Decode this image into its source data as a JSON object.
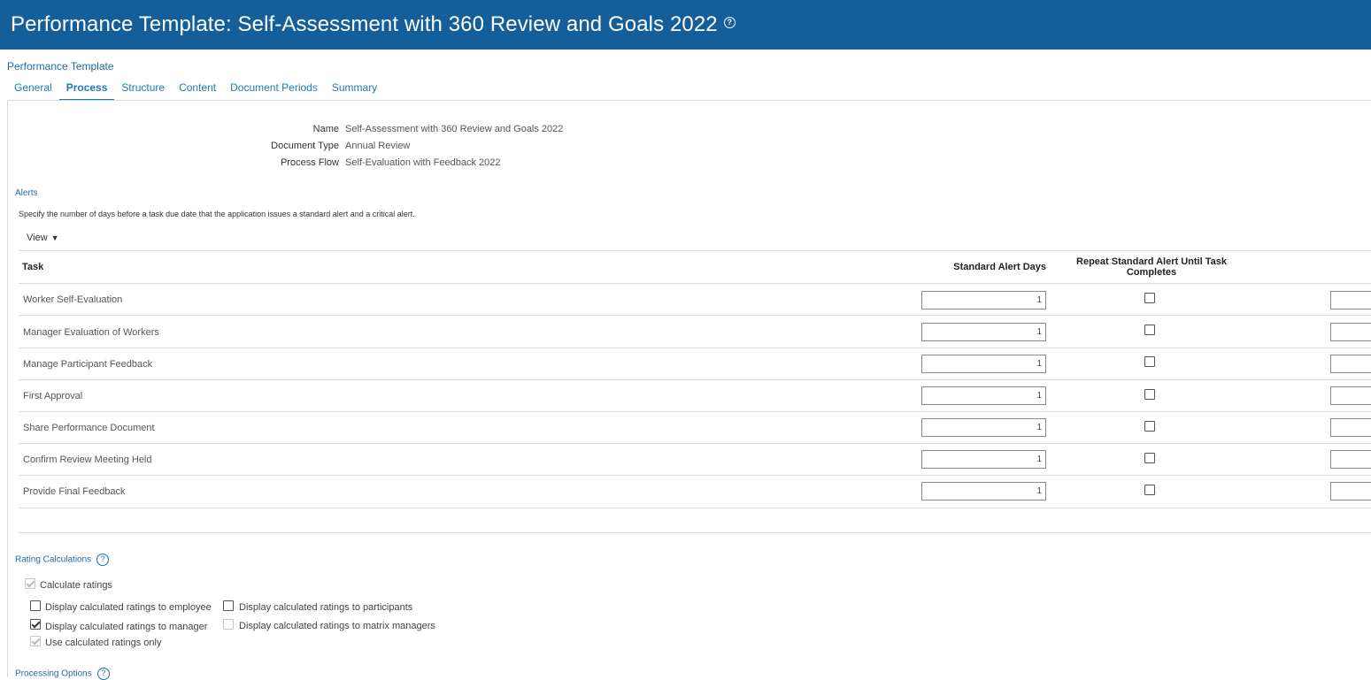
{
  "header": {
    "title": "Performance Template: Self-Assessment with 360 Review and Goals 2022",
    "help_glyph": "?"
  },
  "breadcrumb": "Performance Template",
  "tabs": [
    {
      "label": "General"
    },
    {
      "label": "Process"
    },
    {
      "label": "Structure"
    },
    {
      "label": "Content"
    },
    {
      "label": "Document Periods"
    },
    {
      "label": "Summary"
    }
  ],
  "info": [
    {
      "label": "Name",
      "value": "Self-Assessment with 360 Review and Goals 2022"
    },
    {
      "label": "Document Type",
      "value": "Annual Review"
    },
    {
      "label": "Process Flow",
      "value": "Self-Evaluation with Feedback 2022"
    }
  ],
  "alerts": {
    "title": "Alerts",
    "description": "Specify the number of days before a task due date that the application issues a standard alert and a critical alert.",
    "view_label": "View",
    "columns": {
      "task": "Task",
      "standard_days": "Standard Alert Days",
      "repeat_line1": "Repeat Standard Alert Until Task",
      "repeat_line2": "Completes"
    },
    "rows": [
      {
        "task": "Worker Self-Evaluation",
        "standard_days": "1",
        "repeat": false
      },
      {
        "task": "Manager Evaluation of Workers",
        "standard_days": "1",
        "repeat": false
      },
      {
        "task": "Manage Participant Feedback",
        "standard_days": "1",
        "repeat": false
      },
      {
        "task": "First Approval",
        "standard_days": "1",
        "repeat": false
      },
      {
        "task": "Share Performance Document",
        "standard_days": "1",
        "repeat": false
      },
      {
        "task": "Confirm Review Meeting Held",
        "standard_days": "1",
        "repeat": false
      },
      {
        "task": "Provide Final Feedback",
        "standard_days": "1",
        "repeat": false
      }
    ]
  },
  "rating_calculations": {
    "title": "Rating Calculations",
    "help_glyph": "?",
    "calculate_ratings": {
      "label": "Calculate ratings",
      "checked": true
    },
    "display_employee": {
      "label": "Display calculated ratings to employee",
      "checked": false
    },
    "display_participants": {
      "label": "Display calculated ratings to participants",
      "checked": false
    },
    "display_manager": {
      "label": "Display calculated ratings to manager",
      "checked": true
    },
    "display_matrix": {
      "label": "Display calculated ratings to matrix managers",
      "checked": false
    },
    "use_only": {
      "label": "Use calculated ratings only",
      "checked": true
    }
  },
  "processing_options": {
    "title": "Processing Options",
    "help_glyph": "?"
  }
}
